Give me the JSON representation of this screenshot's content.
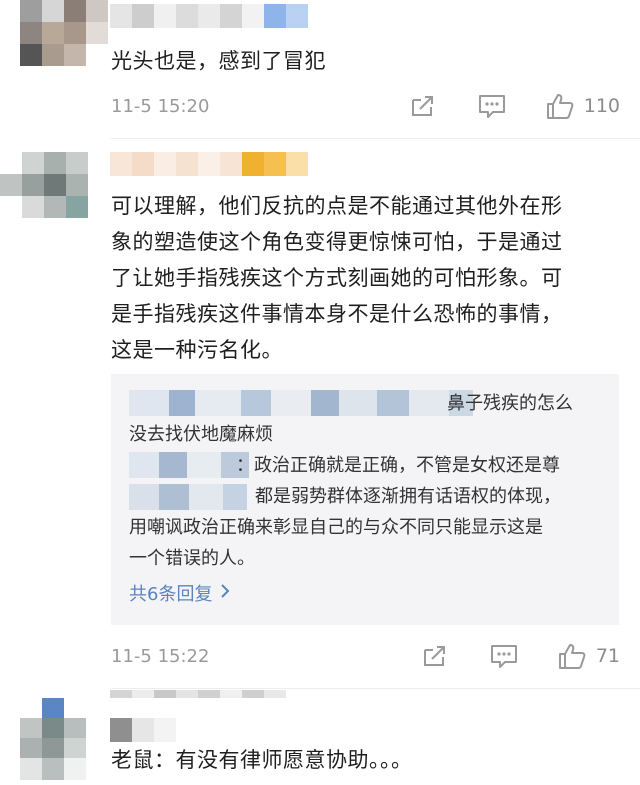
{
  "comments": [
    {
      "text": "光头也是，感到了冒犯",
      "time": "11-5 15:20",
      "likes": "110"
    },
    {
      "lines": [
        "可以理解，他们反抗的点是不能通过其他外在形",
        "象的塑造使这个角色变得更惊悚可怕，于是通过",
        "了让她手指残疾这个方式刻画她的可怕形象。可",
        "是手指残疾这件事情本身不是什么恐怖的事情，",
        "这是一种污名化。"
      ],
      "replies": {
        "first_fragment": "鼻子残疾的怎么",
        "first_line2": "没去找伏地魔麻烦",
        "second_fragment": "：政治正确就是正确，不管是女权还是尊",
        "second_line2_tail": "都是弱势群体逐渐拥有话语权的体现，",
        "second_line3": "用嘲讽政治正确来彰显自己的与众不同只能显示这是",
        "second_line4": "一个错误的人。",
        "more": "共6条回复"
      },
      "time": "11-5 15:22",
      "likes": "71"
    },
    {
      "text": "老鼠：有没有律师愿意协助。。。"
    }
  ],
  "colors": {
    "link": "#5b83bd",
    "meta": "#9a9a9a",
    "reply_bg": "#f4f4f6"
  },
  "icons": [
    "share-icon",
    "comment-icon",
    "like-icon",
    "chevron-right-icon"
  ]
}
